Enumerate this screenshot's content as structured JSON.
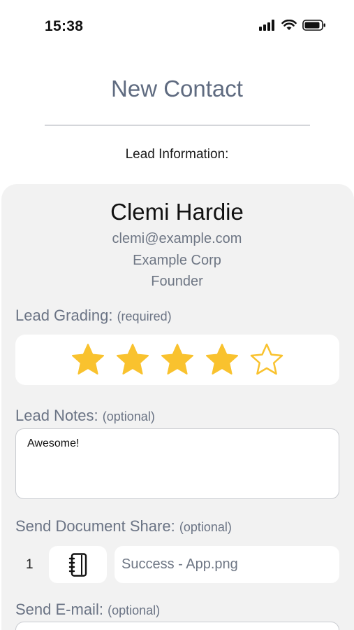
{
  "status_bar": {
    "time": "15:38",
    "icons": [
      "signal-icon",
      "wifi-icon",
      "battery-icon"
    ]
  },
  "header": {
    "title": "New Contact",
    "section_label": "Lead Information:"
  },
  "lead": {
    "name": "Clemi Hardie",
    "email": "clemi@example.com",
    "company": "Example Corp",
    "title": "Founder"
  },
  "grading": {
    "label": "Lead Grading:",
    "hint": "(required)",
    "rating": 4,
    "max": 5,
    "star_color": "#f9c22e"
  },
  "notes": {
    "label": "Lead Notes:",
    "hint": "(optional)",
    "value": "Awesome!"
  },
  "document_share": {
    "label": "Send Document Share:",
    "hint": "(optional)",
    "items": [
      {
        "index": "1",
        "icon": "notebook-icon",
        "file_name": "Success - App.png"
      }
    ]
  },
  "send_email": {
    "label": "Send E-mail:",
    "hint": "(optional)"
  }
}
